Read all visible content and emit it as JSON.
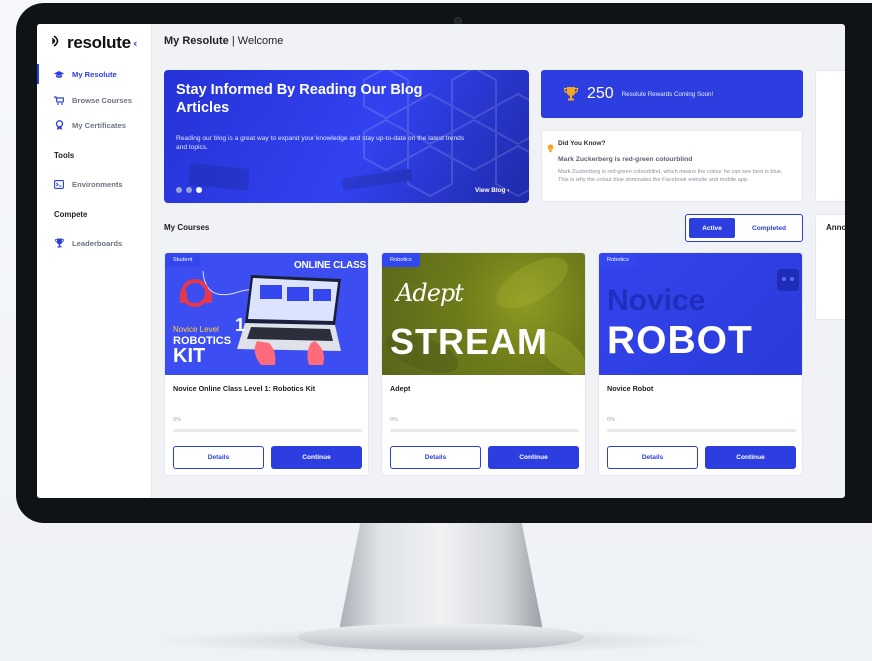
{
  "app": {
    "logo_text": "resolute",
    "collapse_icon": "chevron-left-icon"
  },
  "sidebar": {
    "items": [
      {
        "label": "My Resolute",
        "icon": "graduation-cap-icon",
        "active": true
      },
      {
        "label": "Browse Courses",
        "icon": "cart-icon",
        "active": false
      },
      {
        "label": "My Certificates",
        "icon": "award-icon",
        "active": false
      }
    ],
    "tools_heading": "Tools",
    "tools_items": [
      {
        "label": "Environments",
        "icon": "terminal-icon"
      }
    ],
    "compete_heading": "Compete",
    "compete_items": [
      {
        "label": "Leaderboards",
        "icon": "trophy-icon"
      }
    ]
  },
  "header": {
    "title": "My Resolute",
    "separator": "|",
    "subtitle": "Welcome"
  },
  "hero": {
    "title": "Stay Informed By Reading Our Blog Articles",
    "description": "Reading our blog is a great way to expand your knowledge and stay up-to-date on the latest trends and topics.",
    "cta": "View Blog  ›",
    "slides": 3,
    "active_slide": 3
  },
  "rewards": {
    "points": "250",
    "text": "Resolute Rewards Coming Soon!"
  },
  "did_you_know": {
    "title": "Did You Know?",
    "headline": "Mark Zuckerberg is red-green colourblind",
    "body": "Mark Zuckerberg is red-green colourblind, which means the colour he can see best is blue. This is why the colour blue dominates the Facebook website and mobile app."
  },
  "right_panel": {
    "heading": "Anno"
  },
  "my_courses": {
    "title": "My Courses",
    "tabs": [
      {
        "label": "Active",
        "selected": true
      },
      {
        "label": "Completed",
        "selected": false
      }
    ],
    "courses": [
      {
        "tag": "Student",
        "title": "Novice Online Class Level 1: Robotics Kit",
        "progress_label": "0%",
        "progress": 0,
        "details_label": "Details",
        "continue_label": "Continue",
        "thumb": {
          "top": "ONLINE CLASS",
          "level": "Novice Level",
          "number": "1",
          "line1": "ROBOTICS",
          "line2": "KIT"
        }
      },
      {
        "tag": "Robotics",
        "title": "Adept",
        "progress_label": "0%",
        "progress": 0,
        "details_label": "Details",
        "continue_label": "Continue",
        "thumb": {
          "line1": "Adept",
          "line2": "STREAM"
        }
      },
      {
        "tag": "Robotics",
        "title": "Novice Robot",
        "progress_label": "0%",
        "progress": 0,
        "details_label": "Details",
        "continue_label": "Continue",
        "thumb": {
          "line1": "Novice",
          "line2": "ROBOT"
        }
      }
    ]
  },
  "colors": {
    "accent": "#2c3ee0",
    "reward_icon": "#f5a623",
    "background": "#f1f2f5"
  }
}
